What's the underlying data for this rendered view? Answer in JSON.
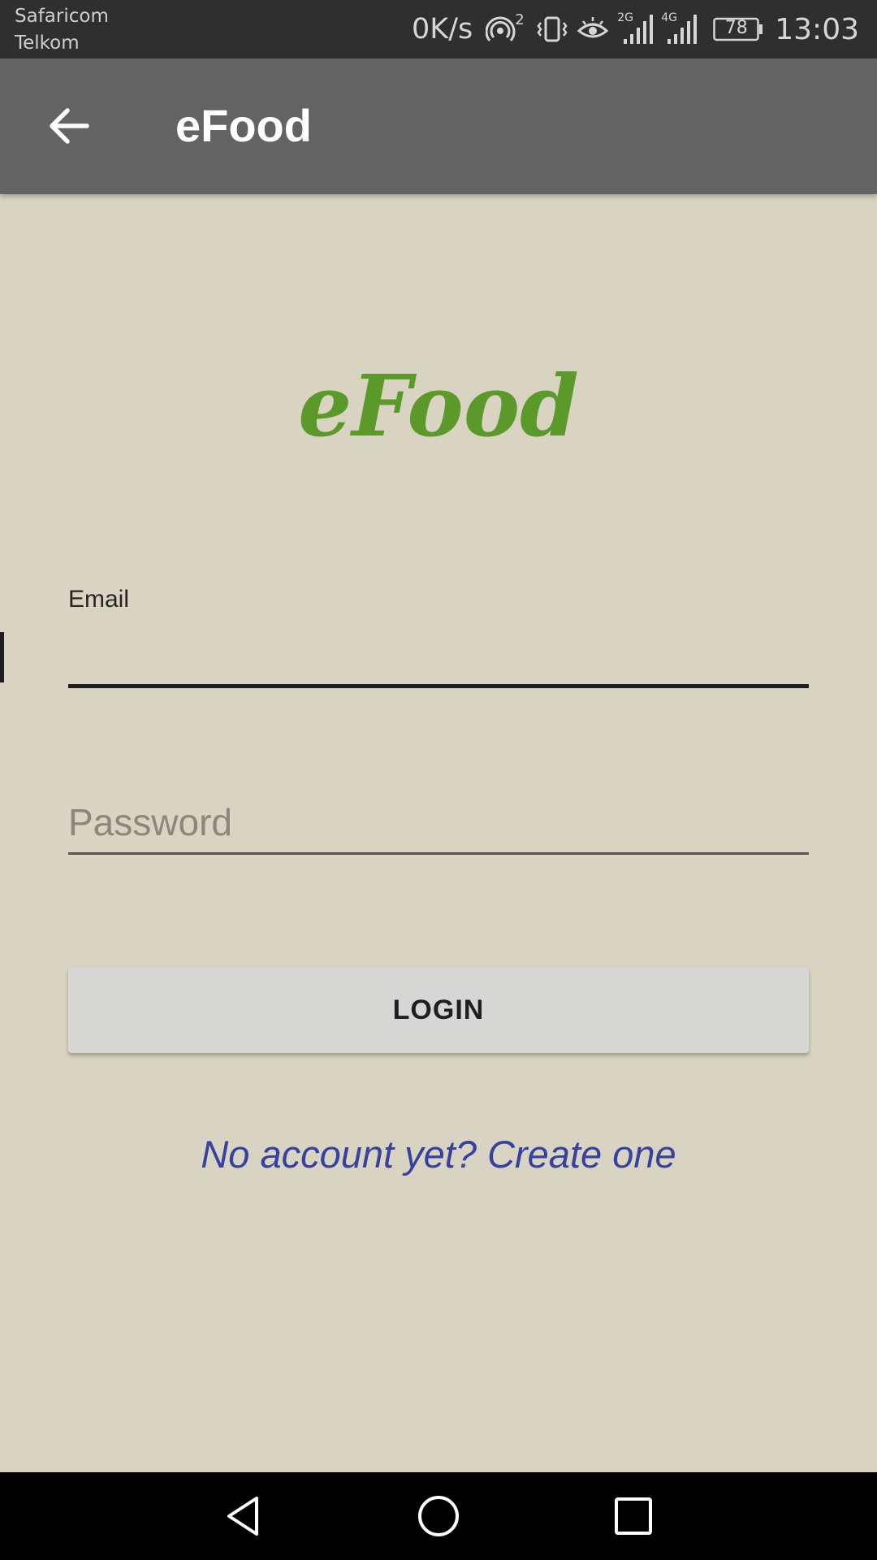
{
  "status_bar": {
    "carrier_1": "Safaricom",
    "carrier_2": "Telkom",
    "network_speed": "0K/s",
    "hotspot_count": "2",
    "sim1_network": "2G",
    "sim2_network": "4G",
    "battery_level": "78",
    "time": "13:03"
  },
  "app_bar": {
    "title": "eFood",
    "back_icon": "arrow-left-icon"
  },
  "logo": {
    "text": "eFood",
    "color": "#5b9a2a"
  },
  "form": {
    "email_label": "Email",
    "email_value": "",
    "password_placeholder": "Password",
    "password_value": "",
    "login_label": "LOGIN",
    "create_account_link": "No account yet? Create one"
  },
  "colors": {
    "background": "#d9d4c1",
    "app_bar": "#636363",
    "link": "#3641a0",
    "button": "#d6d7d4"
  },
  "nav_bar": {
    "icons": [
      "triangle-back-icon",
      "circle-home-icon",
      "square-recents-icon"
    ]
  }
}
